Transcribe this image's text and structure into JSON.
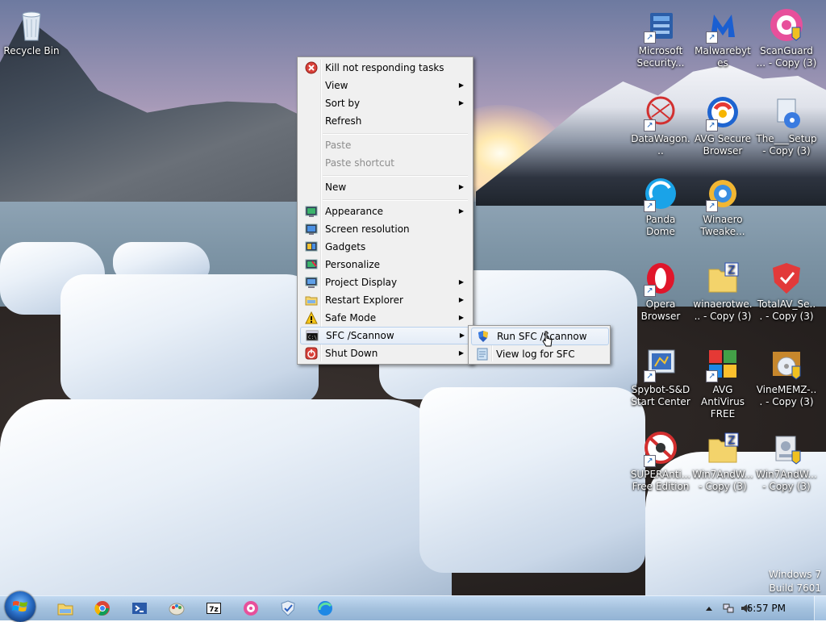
{
  "desktop": {
    "icons": [
      {
        "label": "Recycle Bin",
        "icon": "recycle-bin-icon"
      },
      {
        "label": "Microsoft Security...",
        "icon": "microsoft-security-icon"
      },
      {
        "label": "Malwarebytes",
        "icon": "malwarebytes-icon"
      },
      {
        "label": "ScanGuard ... - Copy (3)",
        "icon": "scanguard-icon"
      },
      {
        "label": "DataWagon...",
        "icon": "datawagon-icon"
      },
      {
        "label": "AVG Secure Browser",
        "icon": "avg-secure-browser-icon"
      },
      {
        "label": "The___Setup - Copy (3)",
        "icon": "setup-icon"
      },
      {
        "label": "Panda Dome",
        "icon": "panda-dome-icon"
      },
      {
        "label": "Winaero Tweake...",
        "icon": "winaero-tweaker-icon"
      },
      {
        "label": "Opera Browser",
        "icon": "opera-icon"
      },
      {
        "label": "winaerotwe... - Copy (3)",
        "icon": "zip-folder-icon"
      },
      {
        "label": "TotalAV_Se... - Copy (3)",
        "icon": "totalav-icon"
      },
      {
        "label": "Spybot-S&D Start Center",
        "icon": "spybot-icon"
      },
      {
        "label": "AVG AntiVirus FREE",
        "icon": "avg-antivirus-icon"
      },
      {
        "label": "VineMEMZ-... - Copy (3)",
        "icon": "vinememz-icon"
      },
      {
        "label": "SUPERAnti... Free Edition",
        "icon": "superantispyware-icon"
      },
      {
        "label": "Win7AndW... - Copy (3)",
        "icon": "zip-folder-icon"
      },
      {
        "label": "Win7AndW... - Copy (3)",
        "icon": "installer-icon"
      }
    ]
  },
  "context_menu": {
    "items": [
      {
        "label": "Kill not responding tasks",
        "icon": "kill-tasks-icon",
        "submenu": false,
        "disabled": false
      },
      {
        "label": "View",
        "submenu": true,
        "disabled": false
      },
      {
        "label": "Sort by",
        "submenu": true,
        "disabled": false
      },
      {
        "label": "Refresh",
        "submenu": false,
        "disabled": false
      },
      {
        "label": "Paste",
        "submenu": false,
        "disabled": true
      },
      {
        "label": "Paste shortcut",
        "submenu": false,
        "disabled": true
      },
      {
        "label": "New",
        "submenu": true,
        "disabled": false
      },
      {
        "label": "Appearance",
        "icon": "appearance-icon",
        "submenu": true,
        "disabled": false
      },
      {
        "label": "Screen resolution",
        "icon": "screen-resolution-icon",
        "submenu": false,
        "disabled": false
      },
      {
        "label": "Gadgets",
        "icon": "gadgets-icon",
        "submenu": false,
        "disabled": false
      },
      {
        "label": "Personalize",
        "icon": "personalize-icon",
        "submenu": false,
        "disabled": false
      },
      {
        "label": "Project Display",
        "icon": "project-display-icon",
        "submenu": true,
        "disabled": false
      },
      {
        "label": "Restart Explorer",
        "icon": "restart-explorer-icon",
        "submenu": true,
        "disabled": false
      },
      {
        "label": "Safe Mode",
        "icon": "warning-icon",
        "submenu": true,
        "disabled": false
      },
      {
        "label": "SFC /Scannow",
        "icon": "command-prompt-icon",
        "submenu": true,
        "disabled": false,
        "highlighted": true
      },
      {
        "label": "Shut Down",
        "icon": "shutdown-icon",
        "submenu": true,
        "disabled": false
      }
    ],
    "submenu_arrow": "▶"
  },
  "sfc_submenu": {
    "items": [
      {
        "label": "Run SFC /Scannow",
        "icon": "uac-shield-icon",
        "highlighted": true
      },
      {
        "label": "View log for SFC",
        "icon": "log-file-icon"
      }
    ]
  },
  "taskbar": {
    "pinned": [
      "explorer-icon",
      "chrome-icon",
      "powershell-icon",
      "paint-icon",
      "7zip-icon",
      "app-icon",
      "shield-check-icon",
      "edge-icon"
    ],
    "clock": "6:57 PM",
    "tray": [
      "show-hidden-icons-icon",
      "network-icon",
      "volume-icon"
    ]
  },
  "watermark": {
    "line1": "Windows 7",
    "line2": "Build 7601"
  }
}
